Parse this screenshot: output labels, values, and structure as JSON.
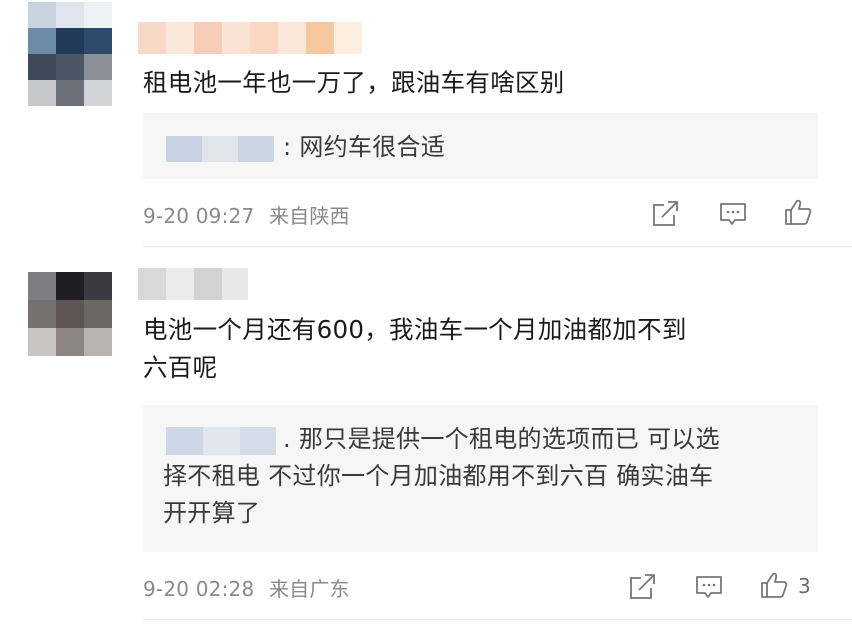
{
  "comments": [
    {
      "text": "租电池一年也一万了，跟油车有啥区别",
      "reply": {
        "text": ": 网约车很合适"
      },
      "time": "9-20 09:27",
      "location": "来自陕西",
      "likes": "",
      "icons": [
        "share-icon",
        "comment-icon",
        "like-icon"
      ]
    },
    {
      "text_line1": "电池一个月还有600，我油车一个月加油都加不到",
      "text_line2": "六百呢",
      "reply": {
        "line1": ". 那只是提供一个租电的选项而已 可以选",
        "line2": "择不租电 不过你一个月加油都用不到六百 确实油车",
        "line3": "开开算了"
      },
      "time": "9-20 02:28",
      "location": "来自广东",
      "likes": "3",
      "icons": [
        "share-icon",
        "comment-icon",
        "like-icon"
      ]
    }
  ],
  "colors": {
    "icon": "#777777",
    "meta": "#8a8a8a",
    "reply_bg": "#f6f6f6"
  }
}
